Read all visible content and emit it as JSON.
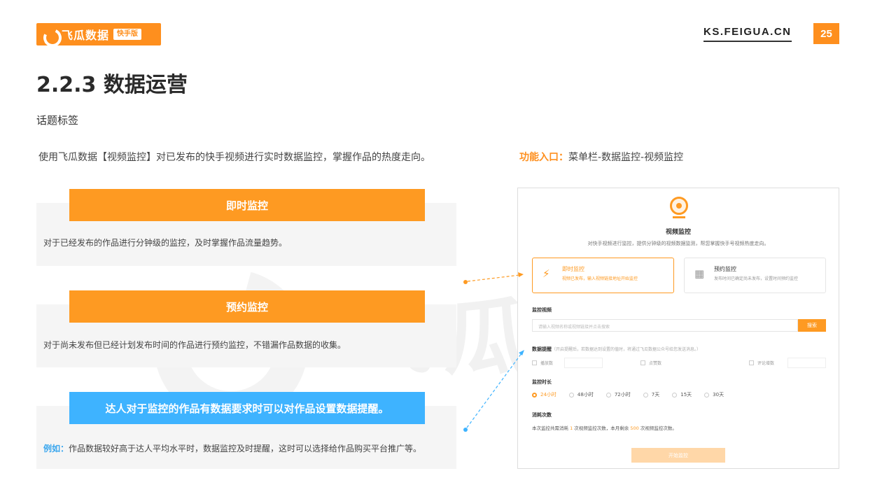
{
  "header": {
    "brand_name": "飞瓜数据",
    "brand_tag": "快手版",
    "site": "KS.FEIGUA.CN",
    "page_number": "25"
  },
  "watermark": "飞瓜数据",
  "title": "2.2.3 数据运营",
  "subtitle": "话题标签",
  "intro": "使用飞瓜数据【视频监控】对已发布的快手视频进行实时数据监控，掌握作品的热度走向。",
  "entry": {
    "label": "功能入口：",
    "path": "菜单栏-数据监控-视频监控"
  },
  "features": [
    {
      "heading": "即时监控",
      "text": "对于已经发布的作品进行分钟级的监控，及时掌握作品流量趋势。"
    },
    {
      "heading": "预约监控",
      "text": "对于尚未发布但已经计划发布时间的作品进行预约监控，不错漏作品数据的收集。"
    },
    {
      "heading": "达人对于监控的作品有数据要求时可以对作品设置数据提醒。",
      "example_label": "例如：",
      "text": "作品数据较好高于达人平均水平时，数据监控及时提醒，这时可以选择给作品购买平台推广等。"
    }
  ],
  "screenshot": {
    "title": "视频监控",
    "desc": "对快手视频进行监控，提供分钟级的视频数据监测，帮您掌握快手号视频热度走向。",
    "cards": [
      {
        "name": "即时监控",
        "desc": "视频已发布，输入视频链接地址开始监控"
      },
      {
        "name": "预约监控",
        "desc": "发布时间已确定尚未发布，设置时间预约监控"
      }
    ],
    "video_label": "监控视频",
    "search_placeholder": "请输入视频名称或视频链接并点击搜索",
    "search_button": "搜索",
    "alert_label": "数据提醒",
    "alert_note": "（开启提醒后，若数据达到设置的值时，将通过飞瓜数据公众号给您发送消息。）",
    "alert_options": [
      "播放数",
      "点赞数",
      "评论增数"
    ],
    "duration_label": "监控时长",
    "durations": [
      "24小时",
      "48小时",
      "72小时",
      "7天",
      "15天",
      "30天"
    ],
    "cost_label": "消耗次数",
    "cost_pre": "本次监控共需消耗 ",
    "cost_num": "1",
    "cost_mid": " 次视频监控次数，本月剩余 ",
    "cost_remain": "500",
    "cost_post": " 次视频监控次数。",
    "start_button": "开始监控"
  },
  "colors": {
    "accent": "#fe9a22",
    "blue": "#3eb3ff"
  }
}
